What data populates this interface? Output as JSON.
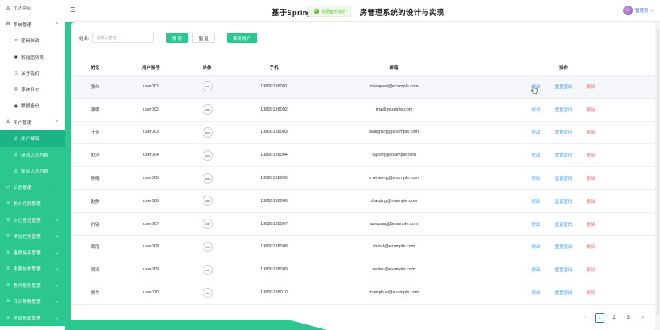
{
  "header": {
    "title_left": "基于Spring",
    "title_right": "房管理系统的设计与实现",
    "toast": "数据备份成功",
    "user": "管理员"
  },
  "sidebar": {
    "items": [
      {
        "label": "个人中心",
        "icon": "person-icon",
        "chev": ""
      },
      {
        "label": "系统管理",
        "icon": "gear-icon",
        "chev": "^"
      },
      {
        "label": "密码修改",
        "icon": "key-icon",
        "chev": "",
        "sub": true
      },
      {
        "label": "轮播图列表",
        "icon": "image-icon",
        "chev": "",
        "sub": true
      },
      {
        "label": "关于我们",
        "icon": "info-icon",
        "chev": "",
        "sub": true
      },
      {
        "label": "系统日志",
        "icon": "log-icon",
        "chev": "",
        "sub": true
      },
      {
        "label": "数据备份",
        "icon": "backup-icon",
        "chev": "",
        "sub": true
      },
      {
        "label": "用户管理",
        "icon": "users-icon",
        "chev": "^"
      },
      {
        "label": "用户编辑",
        "icon": "person-icon",
        "chev": "",
        "sub": true,
        "active": true
      },
      {
        "label": "清洁人员列表",
        "icon": "person-icon",
        "chev": "",
        "sub": true
      },
      {
        "label": "前台人员列表",
        "icon": "person-icon",
        "chev": "",
        "sub": true
      },
      {
        "label": "公告管理",
        "icon": "bell-icon",
        "chev": "v"
      },
      {
        "label": "积分兑换管理",
        "icon": "list-icon",
        "chev": "v"
      },
      {
        "label": "入住登记管理",
        "icon": "list-icon",
        "chev": "v"
      },
      {
        "label": "清洁任务管理",
        "icon": "list-icon",
        "chev": "v"
      },
      {
        "label": "客房用品管理",
        "icon": "list-icon",
        "chev": "v"
      },
      {
        "label": "发票信息管理",
        "icon": "list-icon",
        "chev": "v"
      },
      {
        "label": "教师服务管理",
        "icon": "list-icon",
        "chev": "v"
      },
      {
        "label": "床价策略管理",
        "icon": "list-icon",
        "chev": "v"
      },
      {
        "label": "房间信息管理",
        "icon": "list-icon",
        "chev": "v"
      }
    ]
  },
  "search": {
    "label": "姓名:",
    "placeholder": "请输入姓名",
    "search_btn": "搜 索",
    "reset_btn": "重 置",
    "add_btn": "新增用户"
  },
  "table": {
    "headers": [
      "姓名",
      "用户账号",
      "头像",
      "手机",
      "邮箱",
      "操作"
    ],
    "ops": {
      "edit": "修改",
      "reset": "重置密码",
      "delete": "删除"
    },
    "rows": [
      {
        "name": "张伟",
        "account": "user001",
        "phone": "13800138001",
        "email": "zhangwei@example.com"
      },
      {
        "name": "李娜",
        "account": "user002",
        "phone": "13800138002",
        "email": "lina@example.com"
      },
      {
        "name": "王芳",
        "account": "user003",
        "phone": "13800138003",
        "email": "wangfang@example.com"
      },
      {
        "name": "刘洋",
        "account": "user004",
        "phone": "13800138004",
        "email": "liuyang@example.com"
      },
      {
        "name": "陈明",
        "account": "user005",
        "phone": "13800138005",
        "email": "chenming@example.com"
      },
      {
        "name": "赵静",
        "account": "user006",
        "phone": "13800138006",
        "email": "zhaojing@example.com"
      },
      {
        "name": "孙强",
        "account": "user007",
        "phone": "13800138007",
        "email": "sunqiang@example.com"
      },
      {
        "name": "周丽",
        "account": "user008",
        "phone": "13800138008",
        "email": "zhouli@example.com"
      },
      {
        "name": "吴涛",
        "account": "user009",
        "phone": "13800138009",
        "email": "wutao@example.com"
      },
      {
        "name": "郑华",
        "account": "user010",
        "phone": "13800138010",
        "email": "zhenghua@example.com"
      }
    ]
  },
  "pagination": {
    "pages": [
      "1",
      "2",
      "3"
    ],
    "current": "1",
    "prev": "<",
    "next": ">"
  },
  "colors": {
    "accent": "#2cc68f",
    "link": "#409eff",
    "danger": "#f56c6c"
  }
}
